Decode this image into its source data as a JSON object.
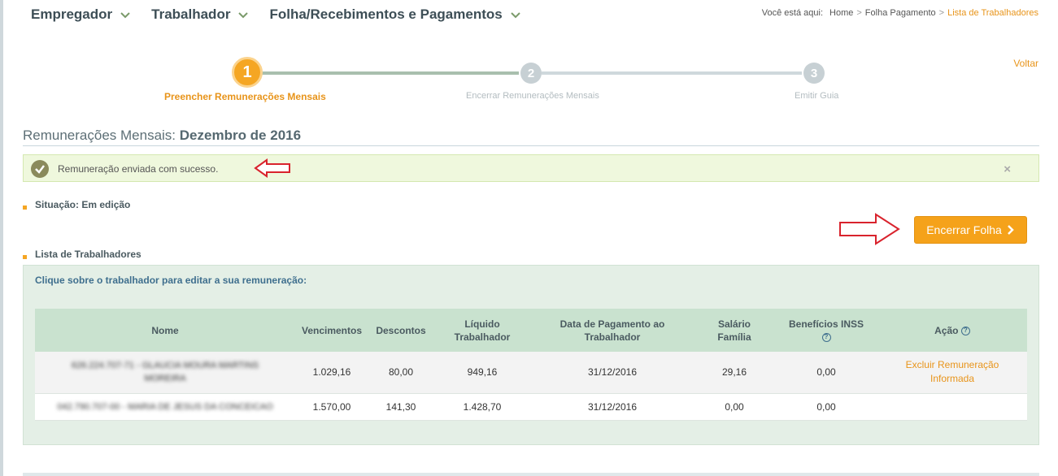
{
  "nav": {
    "items": [
      {
        "label": "Empregador"
      },
      {
        "label": "Trabalhador"
      },
      {
        "label": "Folha/Recebimentos e Pagamentos"
      }
    ]
  },
  "breadcrumb": {
    "prefix": "Você está aqui:",
    "home": "Home",
    "folha": "Folha Pagamento",
    "current": "Lista de Trabalhadores",
    "separator": ">"
  },
  "voltar": "Voltar",
  "stepper": {
    "steps": [
      {
        "number": "1",
        "label": "Preencher Remunerações Mensais"
      },
      {
        "number": "2",
        "label": "Encerrar Remunerações Mensais"
      },
      {
        "number": "3",
        "label": "Emitir Guia"
      }
    ]
  },
  "title": {
    "prefix": "Remunerações Mensais:",
    "month": "Dezembro de 2016"
  },
  "alert": {
    "message": "Remuneração enviada com sucesso.",
    "close": "×"
  },
  "situacao": "Situação: Em edição",
  "lista_label": "Lista de Trabalhadores",
  "button_encerrar": "Encerrar Folha",
  "panel_hint": "Clique sobre o trabalhador para editar a sua remuneração:",
  "table": {
    "headers": {
      "nome": "Nome",
      "vencimentos": "Vencimentos",
      "descontos": "Descontos",
      "liquido_1": "Líquido",
      "liquido_2": "Trabalhador",
      "data_1": "Data de Pagamento ao",
      "data_2": "Trabalhador",
      "salario_1": "Salário",
      "salario_2": "Família",
      "beneficios": "Benefícios INSS",
      "acao": "Ação",
      "help": "?"
    },
    "rows": [
      {
        "nome_1": "626.224.707-71 - GLAUCIA MOURA MARTINS",
        "nome_2": "MOREIRA",
        "vencimentos": "1.029,16",
        "descontos": "80,00",
        "liquido": "949,16",
        "data": "31/12/2016",
        "salario": "29,16",
        "beneficios": "0,00",
        "acao_1": "Excluir Remuneração",
        "acao_2": "Informada"
      },
      {
        "nome_1": "042.790.707-00 - MARIA DE JESUS DA CONCEICAO",
        "vencimentos": "1.570,00",
        "descontos": "141,30",
        "liquido": "1.428,70",
        "data": "31/12/2016",
        "salario": "0,00",
        "beneficios": "0,00"
      }
    ]
  },
  "colors": {
    "accent": "#f5a21a",
    "nav_text": "#3d4e56",
    "alert_bg": "#eff8dd",
    "panel_bg": "#e4efe6",
    "table_header": "#c9e2cf",
    "annotation_arrow": "#d9232d"
  }
}
